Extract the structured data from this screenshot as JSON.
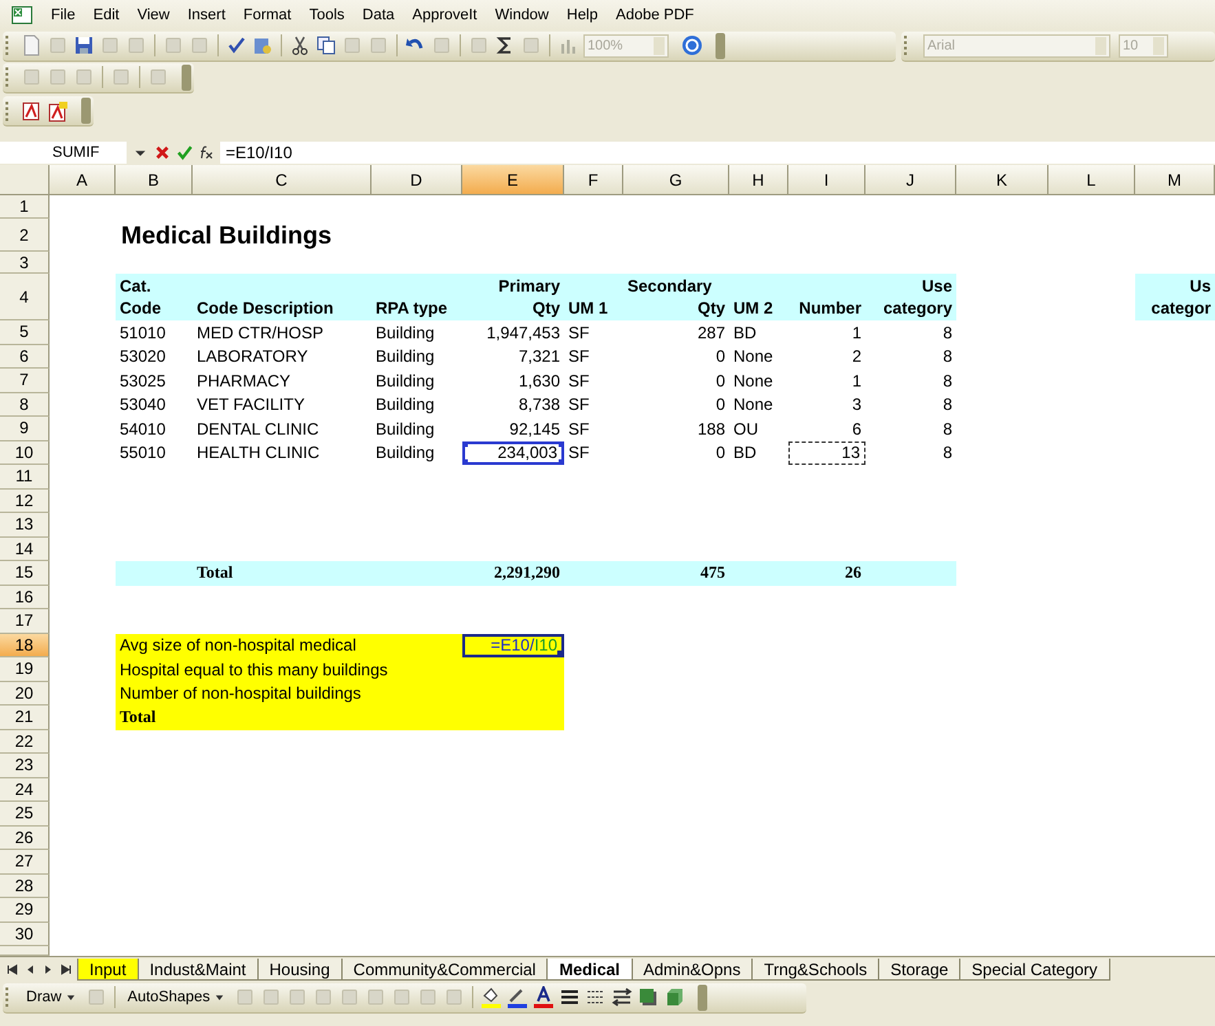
{
  "menu": [
    "File",
    "Edit",
    "View",
    "Insert",
    "Format",
    "Tools",
    "Data",
    "ApproveIt",
    "Window",
    "Help",
    "Adobe PDF"
  ],
  "toolbar": {
    "zoom": "100%",
    "font": "Arial",
    "size": "10"
  },
  "formula_bar": {
    "name_box": "SUMIF",
    "formula": "=E10/I10"
  },
  "columns": [
    {
      "label": "A",
      "selected": false
    },
    {
      "label": "B",
      "selected": false
    },
    {
      "label": "C",
      "selected": false
    },
    {
      "label": "D",
      "selected": false
    },
    {
      "label": "E",
      "selected": true
    },
    {
      "label": "F",
      "selected": false
    },
    {
      "label": "G",
      "selected": false
    },
    {
      "label": "H",
      "selected": false
    },
    {
      "label": "I",
      "selected": false
    },
    {
      "label": "J",
      "selected": false
    },
    {
      "label": "K",
      "selected": false
    },
    {
      "label": "L",
      "selected": false
    },
    {
      "label": "M",
      "selected": false
    }
  ],
  "row_numbers": [
    {
      "label": "1",
      "selected": false
    },
    {
      "label": "2",
      "selected": false
    },
    {
      "label": "3",
      "selected": false
    },
    {
      "label": "4",
      "selected": false
    },
    {
      "label": "5",
      "selected": false
    },
    {
      "label": "6",
      "selected": false
    },
    {
      "label": "7",
      "selected": false
    },
    {
      "label": "8",
      "selected": false
    },
    {
      "label": "9",
      "selected": false
    },
    {
      "label": "10",
      "selected": false
    },
    {
      "label": "11",
      "selected": false
    },
    {
      "label": "12",
      "selected": false
    },
    {
      "label": "13",
      "selected": false
    },
    {
      "label": "14",
      "selected": false
    },
    {
      "label": "15",
      "selected": false
    },
    {
      "label": "16",
      "selected": false
    },
    {
      "label": "17",
      "selected": false
    },
    {
      "label": "18",
      "selected": true
    },
    {
      "label": "19",
      "selected": false
    },
    {
      "label": "20",
      "selected": false
    },
    {
      "label": "21",
      "selected": false
    },
    {
      "label": "22",
      "selected": false
    },
    {
      "label": "23",
      "selected": false
    },
    {
      "label": "24",
      "selected": false
    },
    {
      "label": "25",
      "selected": false
    },
    {
      "label": "26",
      "selected": false
    },
    {
      "label": "27",
      "selected": false
    },
    {
      "label": "28",
      "selected": false
    },
    {
      "label": "29",
      "selected": false
    },
    {
      "label": "30",
      "selected": false
    }
  ],
  "title": "Medical Buildings",
  "table": {
    "header": [
      {
        "top": "Cat.",
        "bottom": "Code"
      },
      {
        "bottom": "Code Description"
      },
      {
        "bottom": "RPA type"
      },
      {
        "top": "Primary",
        "bottom": "Qty"
      },
      {
        "bottom": "UM 1"
      },
      {
        "top": "Secondary",
        "bottom": "Qty"
      },
      {
        "bottom": "UM 2"
      },
      {
        "bottom": "Number"
      },
      {
        "top": "Use",
        "bottom": "category"
      }
    ],
    "rows": [
      {
        "cells": [
          "51010",
          "MED CTR/HOSP",
          "Building",
          "1,947,453",
          "SF",
          "287",
          "BD",
          "1",
          "8"
        ],
        "qty_selected": false,
        "number_referenced": false
      },
      {
        "cells": [
          "53020",
          "LABORATORY",
          "Building",
          "7,321",
          "SF",
          "0",
          "None",
          "2",
          "8"
        ],
        "qty_selected": false,
        "number_referenced": false
      },
      {
        "cells": [
          "53025",
          "PHARMACY",
          "Building",
          "1,630",
          "SF",
          "0",
          "None",
          "1",
          "8"
        ],
        "qty_selected": false,
        "number_referenced": false
      },
      {
        "cells": [
          "53040",
          "VET FACILITY",
          "Building",
          "8,738",
          "SF",
          "0",
          "None",
          "3",
          "8"
        ],
        "qty_selected": false,
        "number_referenced": false
      },
      {
        "cells": [
          "54010",
          "DENTAL CLINIC",
          "Building",
          "92,145",
          "SF",
          "188",
          "OU",
          "6",
          "8"
        ],
        "qty_selected": false,
        "number_referenced": false
      },
      {
        "cells": [
          "55010",
          "HEALTH CLINIC",
          "Building",
          "234,003",
          "SF",
          "0",
          "BD",
          "13",
          "8"
        ],
        "qty_selected": true,
        "number_referenced": true
      }
    ],
    "total": {
      "label": "Total",
      "primary": "2,291,290",
      "secondary": "475",
      "number": "26"
    }
  },
  "side_header": {
    "top": "Us",
    "bottom": "categor"
  },
  "summary": {
    "lines": [
      {
        "label": "Avg size of non-hospital medical",
        "bold": false
      },
      {
        "label": "Hospital equal to this many buildings",
        "bold": false
      },
      {
        "label": "Number of non-hospital buildings",
        "bold": false
      },
      {
        "label": "Total",
        "bold": true
      }
    ],
    "formula_parts": [
      "=E10/",
      "I10"
    ]
  },
  "sheet_tabs": [
    {
      "label": "Input",
      "selected": false,
      "color": "#ffff00"
    },
    {
      "label": "Indust&Maint",
      "selected": false
    },
    {
      "label": "Housing",
      "selected": false
    },
    {
      "label": "Community&Commercial",
      "selected": false
    },
    {
      "label": "Medical",
      "selected": true
    },
    {
      "label": "Admin&Opns",
      "selected": false
    },
    {
      "label": "Trng&Schools",
      "selected": false
    },
    {
      "label": "Storage",
      "selected": false
    },
    {
      "label": "Special Category",
      "selected": false
    }
  ],
  "drawing_toolbar": {
    "draw": "Draw",
    "autoshapes": "AutoShapes"
  }
}
